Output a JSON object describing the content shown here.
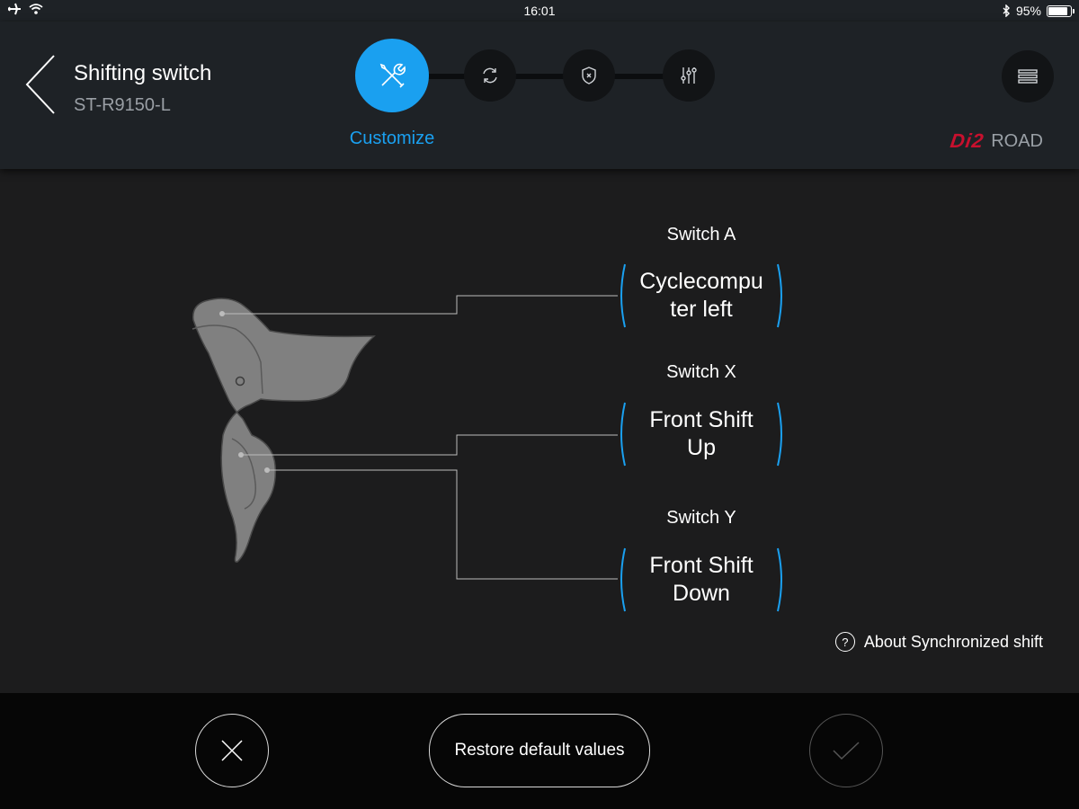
{
  "status_bar": {
    "time": "16:01",
    "battery_percent_text": "95%",
    "battery_level": 0.95,
    "icons": [
      "airplane-icon",
      "wifi-icon",
      "bluetooth-icon",
      "battery-icon"
    ]
  },
  "header": {
    "title": "Shifting switch",
    "subtitle": "ST-R9150-L",
    "active_step_label": "Customize",
    "steps": [
      {
        "icon": "wrench-screwdriver-icon",
        "active": true
      },
      {
        "icon": "sync-icon",
        "active": false
      },
      {
        "icon": "shield-icon",
        "active": false
      },
      {
        "icon": "sliders-icon",
        "active": false
      }
    ],
    "brand": {
      "logo_text": "Di2",
      "suffix": "ROAD",
      "logo_color": "#c8102e"
    },
    "accent_color": "#1aa0f0"
  },
  "switches": [
    {
      "label": "Switch A",
      "value": "Cyclecompu ter left"
    },
    {
      "label": "Switch X",
      "value": "Front Shift Up"
    },
    {
      "label": "Switch Y",
      "value": "Front Shift Down"
    }
  ],
  "about_link": "About Synchronized shift",
  "footer": {
    "restore_label": "Restore default values",
    "cancel_icon": "close-icon",
    "confirm_icon": "check-icon"
  }
}
